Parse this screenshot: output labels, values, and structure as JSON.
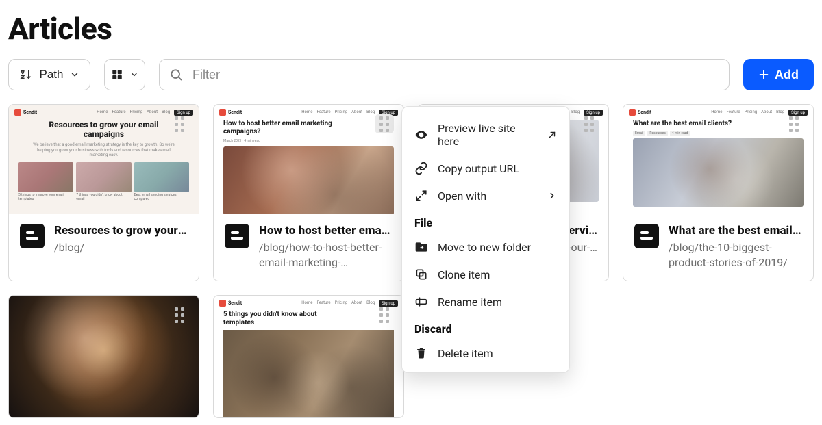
{
  "page": {
    "title": "Articles"
  },
  "toolbar": {
    "sort_label": "Path",
    "search_placeholder": "Filter",
    "add_label": "Add"
  },
  "cards": [
    {
      "title": "Resources to grow your e…",
      "path": "/blog/",
      "thumb_headline": "Resources to grow your email campaigns",
      "thumb_sub": "We believe that a good email marketing strategy is the key to growth. So we're helping you grow your business with tools and resources that make email marketing easy."
    },
    {
      "title": "How to host better email…",
      "path": "/blog/how-to-host-better-email-marketing-…",
      "thumb_headline": "How to host better email marketing campaigns?",
      "handle_active": true
    },
    {
      "title": "…ervi…",
      "path": "…-our-…"
    },
    {
      "title": "What are the best email …",
      "path": "/blog/the-10-biggest-product-stories-of-2019/",
      "thumb_headline": "What are the best email clients?"
    }
  ],
  "context_menu": {
    "preview": "Preview live site here",
    "copy_url": "Copy output URL",
    "open_with": "Open with",
    "section_file": "File",
    "move": "Move to new folder",
    "clone": "Clone item",
    "rename": "Rename item",
    "section_discard": "Discard",
    "delete": "Delete item"
  },
  "thumb_common": {
    "brand": "Sendit",
    "nav": [
      "Home",
      "Feature",
      "Pricing",
      "About",
      "Blog",
      "Sign up"
    ]
  }
}
